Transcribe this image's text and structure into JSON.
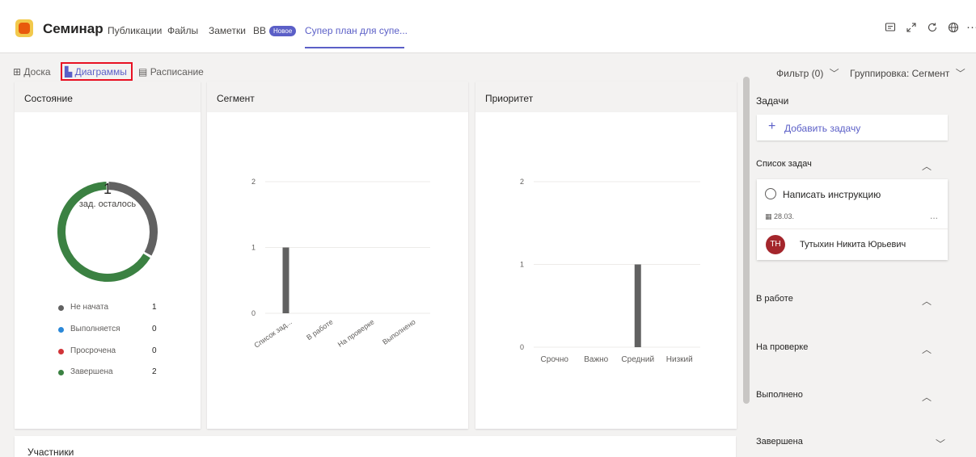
{
  "header": {
    "app_title": "Семинар",
    "tabs": [
      {
        "label": "Публикации"
      },
      {
        "label": "Файлы"
      },
      {
        "label": "Заметки"
      },
      {
        "label": "BB"
      },
      {
        "label": "Супер план для супе..."
      }
    ],
    "badge": "Новое",
    "active_tab_index": 4,
    "icons": [
      "chat-icon",
      "expand-icon",
      "refresh-icon",
      "globe-icon",
      "more-icon"
    ]
  },
  "views": {
    "tabs": [
      {
        "label": "Доска",
        "icon": "board-icon"
      },
      {
        "label": "Диаграммы",
        "icon": "charts-icon",
        "active": true
      },
      {
        "label": "Расписание",
        "icon": "schedule-icon"
      }
    ],
    "filter_label": "Фильтр (0)",
    "group_label": "Группировка: Сегмент"
  },
  "cards": {
    "status_title": "Состояние",
    "segment_title": "Сегмент",
    "priority_title": "Приоритет",
    "members_title": "Участники"
  },
  "donut": {
    "count": "1",
    "label": "зад. осталось"
  },
  "legend": [
    {
      "label": "Не начата",
      "value": "1",
      "color": "#616161"
    },
    {
      "label": "Выполняется",
      "value": "0",
      "color": "#2b88d8"
    },
    {
      "label": "Просрочена",
      "value": "0",
      "color": "#d13438"
    },
    {
      "label": "Завершена",
      "value": "2",
      "color": "#3b8142"
    }
  ],
  "chart_data": [
    {
      "type": "pie",
      "categories": [
        "Не начата",
        "Выполняется",
        "Просрочена",
        "Завершена"
      ],
      "values": [
        1,
        0,
        0,
        2
      ],
      "colors": [
        "#616161",
        "#2b88d8",
        "#d13438",
        "#3b8142"
      ],
      "title": "Состояние"
    },
    {
      "type": "bar",
      "categories": [
        "Список зад...",
        "В работе",
        "На проверке",
        "Выполнено"
      ],
      "values": [
        1,
        0,
        0,
        0
      ],
      "title": "Сегмент",
      "yticks": [
        "0",
        "1",
        "2"
      ],
      "ylim": [
        0,
        2
      ],
      "color": "#616161"
    },
    {
      "type": "bar",
      "categories": [
        "Срочно",
        "Важно",
        "Средний",
        "Низкий"
      ],
      "values": [
        0,
        0,
        1,
        0
      ],
      "title": "Приоритет",
      "yticks": [
        "0",
        "1",
        "2"
      ],
      "ylim": [
        0,
        2
      ],
      "color": "#616161"
    }
  ],
  "right_panel": {
    "tasks_heading": "Задачи",
    "add_task_label": "Добавить задачу",
    "task_list_heading": "Список задач",
    "task": {
      "title": "Написать инструкцию",
      "date": "28.03.",
      "more": "...",
      "assignee_initials": "TH",
      "assignee_name": "Тутыхин Никита Юрьевич"
    },
    "sections": [
      {
        "label": "В работе"
      },
      {
        "label": "На проверке"
      },
      {
        "label": "Выполнено"
      },
      {
        "label": "Завершена"
      }
    ]
  }
}
